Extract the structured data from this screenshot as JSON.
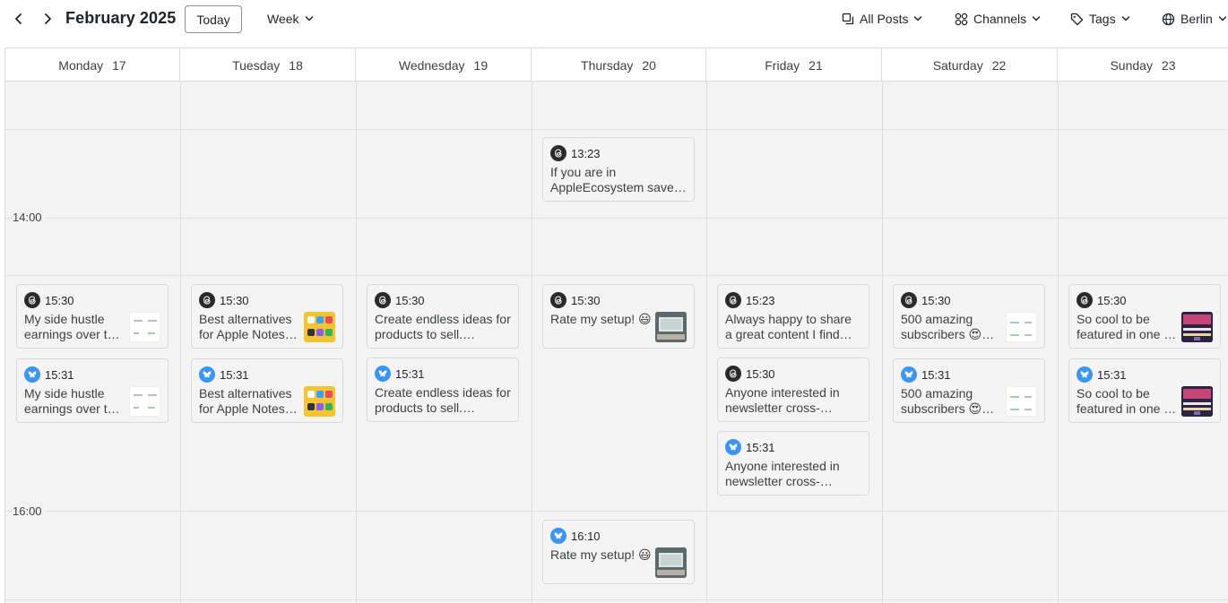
{
  "toolbar": {
    "prev_label": "previous",
    "next_label": "next",
    "title": "February 2025",
    "today_label": "Today",
    "view_label": "Week",
    "filter_posts_label": "All Posts",
    "channels_label": "Channels",
    "tags_label": "Tags",
    "timezone_label": "Berlin"
  },
  "days": [
    {
      "name": "Monday",
      "num": "17"
    },
    {
      "name": "Tuesday",
      "num": "18"
    },
    {
      "name": "Wednesday",
      "num": "19"
    },
    {
      "name": "Thursday",
      "num": "20"
    },
    {
      "name": "Friday",
      "num": "21"
    },
    {
      "name": "Saturday",
      "num": "22"
    },
    {
      "name": "Sunday",
      "num": "23"
    }
  ],
  "time_labels": {
    "t14": "14:00",
    "t16": "16:00"
  },
  "posts": {
    "thu_1323": {
      "channel": "threads",
      "time": "13:23",
      "text": "If you are in AppleEcosystem save…"
    },
    "mon_1530": {
      "channel": "threads",
      "time": "15:30",
      "text": "My side hustle earnings over t…",
      "thumb": "stats"
    },
    "mon_1531": {
      "channel": "bluesky",
      "time": "15:31",
      "text": "My side hustle earnings over t…",
      "thumb": "stats"
    },
    "tue_1530": {
      "channel": "threads",
      "time": "15:30",
      "text": "Best alternatives for Apple Notes…",
      "thumb": "notes-apps"
    },
    "tue_1531": {
      "channel": "bluesky",
      "time": "15:31",
      "text": "Best alternatives for Apple Notes…",
      "thumb": "notes-apps"
    },
    "wed_1530": {
      "channel": "threads",
      "time": "15:30",
      "text": "Create endless ideas for products to sell. Here’s…"
    },
    "wed_1531": {
      "channel": "bluesky",
      "time": "15:31",
      "text": "Create endless ideas for products to sell. Here’s…"
    },
    "thu_1530": {
      "channel": "threads",
      "time": "15:30",
      "text": "Rate my setup! 😃",
      "thumb": "desk-setup"
    },
    "thu_1610": {
      "channel": "bluesky",
      "time": "16:10",
      "text": "Rate my setup! 😃",
      "thumb": "desk-setup"
    },
    "fri_1523": {
      "channel": "threads",
      "time": "15:23",
      "text": "Always happy to share a great content I find…"
    },
    "fri_1530": {
      "channel": "threads",
      "time": "15:30",
      "text": "Anyone interested in newsletter cross-…"
    },
    "fri_1531": {
      "channel": "bluesky",
      "time": "15:31",
      "text": "Anyone interested in newsletter cross-…"
    },
    "sat_1530": {
      "channel": "threads",
      "time": "15:30",
      "text": "500 amazing subscribers 😍…",
      "thumb": "stats"
    },
    "sat_1531": {
      "channel": "bluesky",
      "time": "15:31",
      "text": "500 amazing subscribers 😍…",
      "thumb": "stats"
    },
    "sun_1530": {
      "channel": "threads",
      "time": "15:30",
      "text": "So cool to be featured in one …",
      "thumb": "bites"
    },
    "sun_1531": {
      "channel": "bluesky",
      "time": "15:31",
      "text": "So cool to be featured in one …",
      "thumb": "bites"
    }
  },
  "colors": {
    "threads": "#2a2a2a",
    "bluesky": "#3b95f5",
    "grid_bg": "#f3f3f3"
  },
  "icons": {
    "prev": "chevron-left-icon",
    "next": "chevron-right-icon",
    "posts": "copy-icon",
    "channels": "grid-icon",
    "tags": "tag-icon",
    "timezone": "globe-icon"
  }
}
